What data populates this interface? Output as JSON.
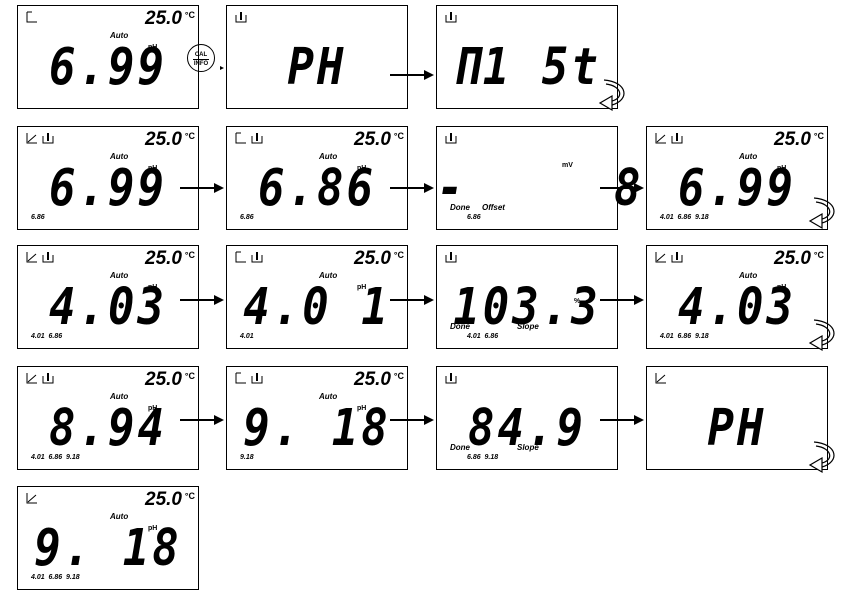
{
  "cal_button": {
    "line1": "CAL",
    "line2": "INFO"
  },
  "screens": [
    {
      "main": "6.99",
      "temp": "25.0",
      "deg": "°C",
      "auto": "Auto",
      "unit": "pH",
      "icons": [
        "line"
      ],
      "done": "",
      "label2": "",
      "buffers": ""
    },
    {
      "main": "PH",
      "temp": "",
      "deg": "",
      "auto": "",
      "unit": "",
      "icons": [
        "beaker"
      ],
      "done": "",
      "label2": "",
      "buffers": ""
    },
    {
      "main": "Π1 5t",
      "temp": "",
      "deg": "",
      "auto": "",
      "unit": "",
      "icons": [
        "beaker"
      ],
      "done": "",
      "label2": "",
      "buffers": ""
    },
    {
      "main": "6.99",
      "temp": "25.0",
      "deg": "°C",
      "auto": "Auto",
      "unit": "pH",
      "icons": [
        "slope",
        "beaker"
      ],
      "done": "",
      "label2": "",
      "buffers": "6.86"
    },
    {
      "main": "6.86",
      "temp": "25.0",
      "deg": "°C",
      "auto": "Auto",
      "unit": "pH",
      "icons": [
        "line",
        "beaker"
      ],
      "done": "",
      "label2": "",
      "buffers": "6.86"
    },
    {
      "main": "-     8",
      "temp": "",
      "deg": "",
      "auto": "",
      "unit": "mV",
      "icons": [
        "beaker"
      ],
      "done": "Done",
      "label2": "Offset",
      "buffers": "6.86"
    },
    {
      "main": "6.99",
      "temp": "25.0",
      "deg": "°C",
      "auto": "Auto",
      "unit": "pH",
      "icons": [
        "slope",
        "beaker"
      ],
      "done": "",
      "label2": "",
      "buffers": "4.01  6.86  9.18"
    },
    {
      "main": "4.03",
      "temp": "25.0",
      "deg": "°C",
      "auto": "Auto",
      "unit": "pH",
      "icons": [
        "slope",
        "beaker"
      ],
      "done": "",
      "label2": "",
      "buffers": "4.01  6.86"
    },
    {
      "main": "4.0 1",
      "temp": "25.0",
      "deg": "°C",
      "auto": "Auto",
      "unit": "pH",
      "icons": [
        "line",
        "beaker"
      ],
      "done": "",
      "label2": "",
      "buffers": "4.01"
    },
    {
      "main": "103.3",
      "temp": "",
      "deg": "",
      "auto": "",
      "unit": "%",
      "icons": [
        "beaker"
      ],
      "done": "Done",
      "label2": "Slope",
      "buffers": "4.01  6.86"
    },
    {
      "main": "4.03",
      "temp": "25.0",
      "deg": "°C",
      "auto": "Auto",
      "unit": "pH",
      "icons": [
        "slope",
        "beaker"
      ],
      "done": "",
      "label2": "",
      "buffers": "4.01  6.86  9.18"
    },
    {
      "main": "8.94",
      "temp": "25.0",
      "deg": "°C",
      "auto": "Auto",
      "unit": "pH",
      "icons": [
        "slope",
        "beaker"
      ],
      "done": "",
      "label2": "",
      "buffers": "4.01  6.86  9.18"
    },
    {
      "main": "9. 18",
      "temp": "25.0",
      "deg": "°C",
      "auto": "Auto",
      "unit": "pH",
      "icons": [
        "line",
        "beaker"
      ],
      "done": "",
      "label2": "",
      "buffers": "9.18"
    },
    {
      "main": "84.9",
      "temp": "",
      "deg": "",
      "auto": "",
      "unit": "%",
      "icons": [
        "beaker"
      ],
      "done": "Done",
      "label2": "Slope",
      "buffers": "6.86  9.18"
    },
    {
      "main": "PH",
      "temp": "",
      "deg": "",
      "auto": "",
      "unit": "",
      "icons": [
        "slope"
      ],
      "done": "",
      "label2": "",
      "buffers": ""
    },
    {
      "main": "9. 18",
      "temp": "25.0",
      "deg": "°C",
      "auto": "Auto",
      "unit": "pH",
      "icons": [
        "slope"
      ],
      "done": "",
      "label2": "",
      "buffers": "4.01  6.86  9.18"
    }
  ]
}
